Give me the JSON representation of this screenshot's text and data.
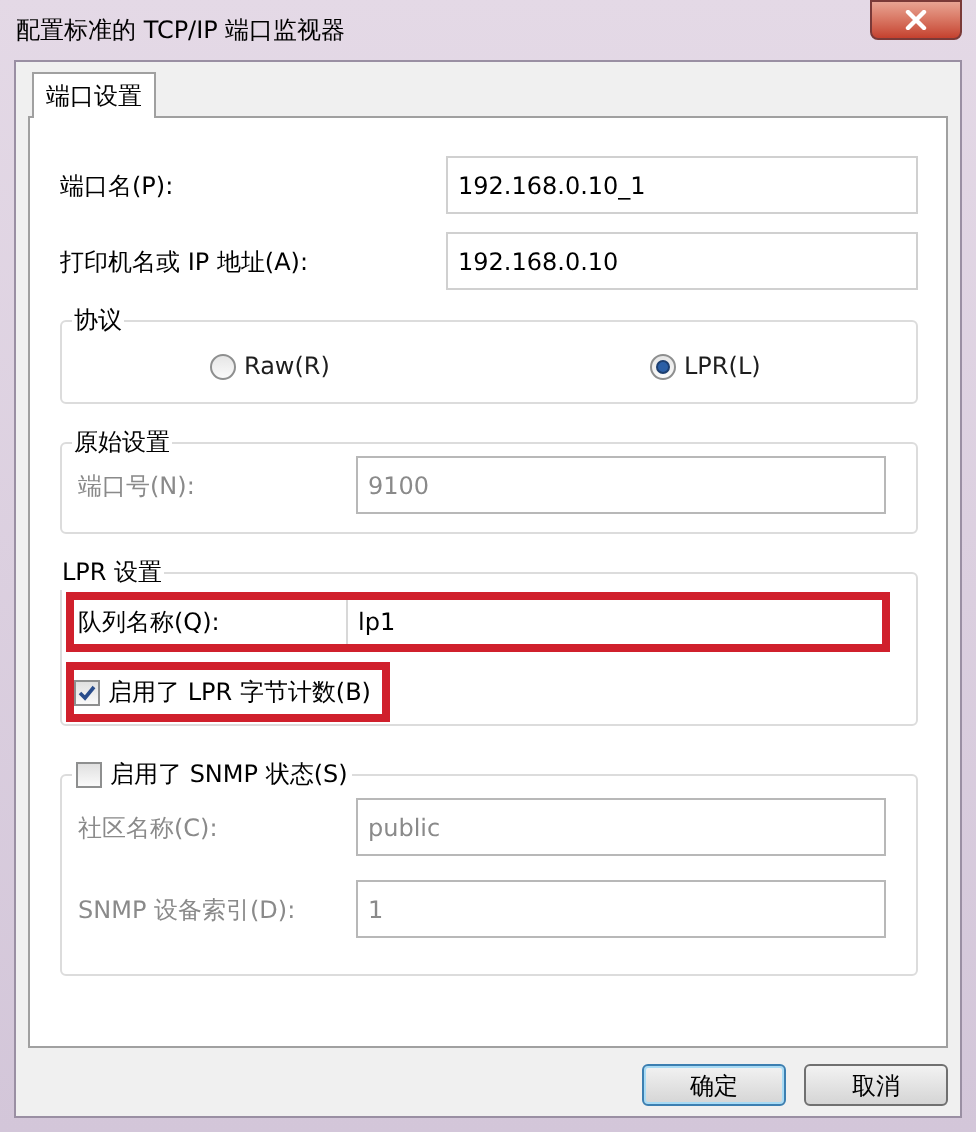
{
  "window": {
    "title": "配置标准的 TCP/IP 端口监视器"
  },
  "tabs": [
    {
      "label": "端口设置",
      "selected": true
    }
  ],
  "fields": [
    {
      "label": "端口名(P):",
      "value": "192.168.0.10_1"
    },
    {
      "label": "打印机名或 IP 地址(A):",
      "value": "192.168.0.10"
    }
  ],
  "protocol": {
    "title": "协议",
    "options": [
      {
        "label": "Raw(R)",
        "selected": false
      },
      {
        "label": "LPR(L)",
        "selected": true
      }
    ]
  },
  "raw_settings": {
    "title": "原始设置",
    "fields": [
      {
        "label": "端口号(N):",
        "value": "9100",
        "disabled": true
      }
    ]
  },
  "lpr_settings": {
    "title": "LPR 设置",
    "queue": {
      "label": "队列名称(Q):",
      "value": "lp1",
      "highlighted": true
    },
    "byte_counting": {
      "label": "启用了 LPR 字节计数(B)",
      "checked": true,
      "highlighted": true
    }
  },
  "snmp": {
    "label": "启用了 SNMP 状态(S)",
    "checked": false,
    "fields": [
      {
        "label": "社区名称(C):",
        "value": "public",
        "disabled": true
      },
      {
        "label": "SNMP 设备索引(D):",
        "value": "1",
        "disabled": true
      }
    ]
  },
  "buttons": [
    {
      "label": "确定",
      "default": true
    },
    {
      "label": "取消",
      "default": false
    }
  ]
}
